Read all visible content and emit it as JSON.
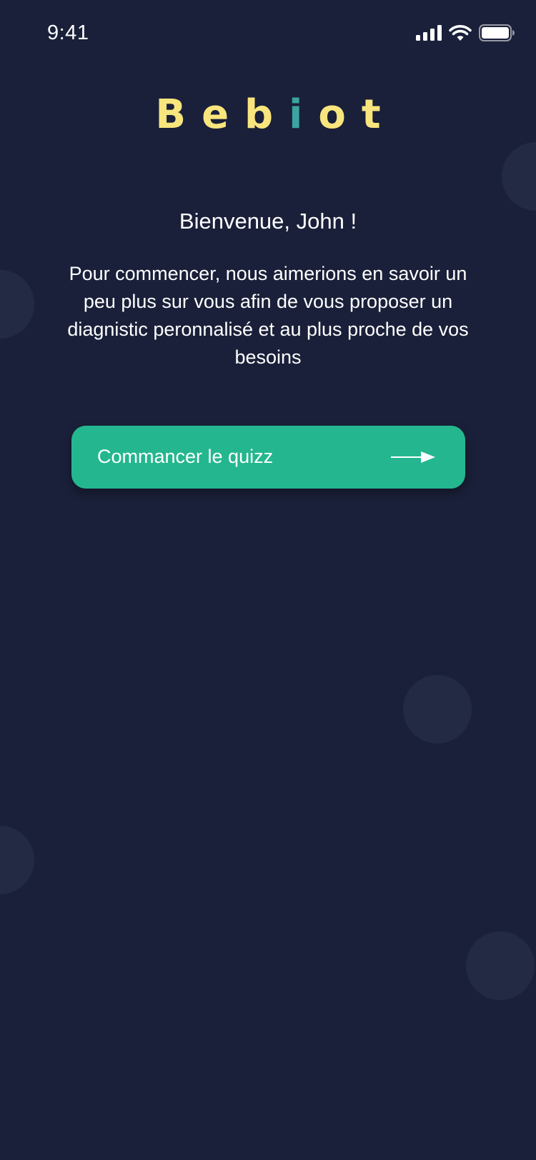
{
  "status_bar": {
    "time": "9:41",
    "icons": [
      "signal-icon",
      "wifi-icon",
      "battery-icon"
    ]
  },
  "logo": {
    "letters_before": "Beb",
    "letter_i": "i",
    "letters_after": "ot",
    "colors": {
      "primary": "#f8e57d",
      "accent_i": "#3aa5a0"
    }
  },
  "welcome": {
    "title": "Bienvenue, John !",
    "text": "Pour commencer, nous aimerions en savoir un peu plus sur vous afin de vous proposer un diagnistic peronnalisé et au plus proche de vos besoins"
  },
  "start_button": {
    "label": "Commancer le quizz",
    "icon": "arrow-right-icon",
    "color": "#24b78f"
  },
  "theme": {
    "background": "#1a2039",
    "bubble": "#232a44"
  }
}
